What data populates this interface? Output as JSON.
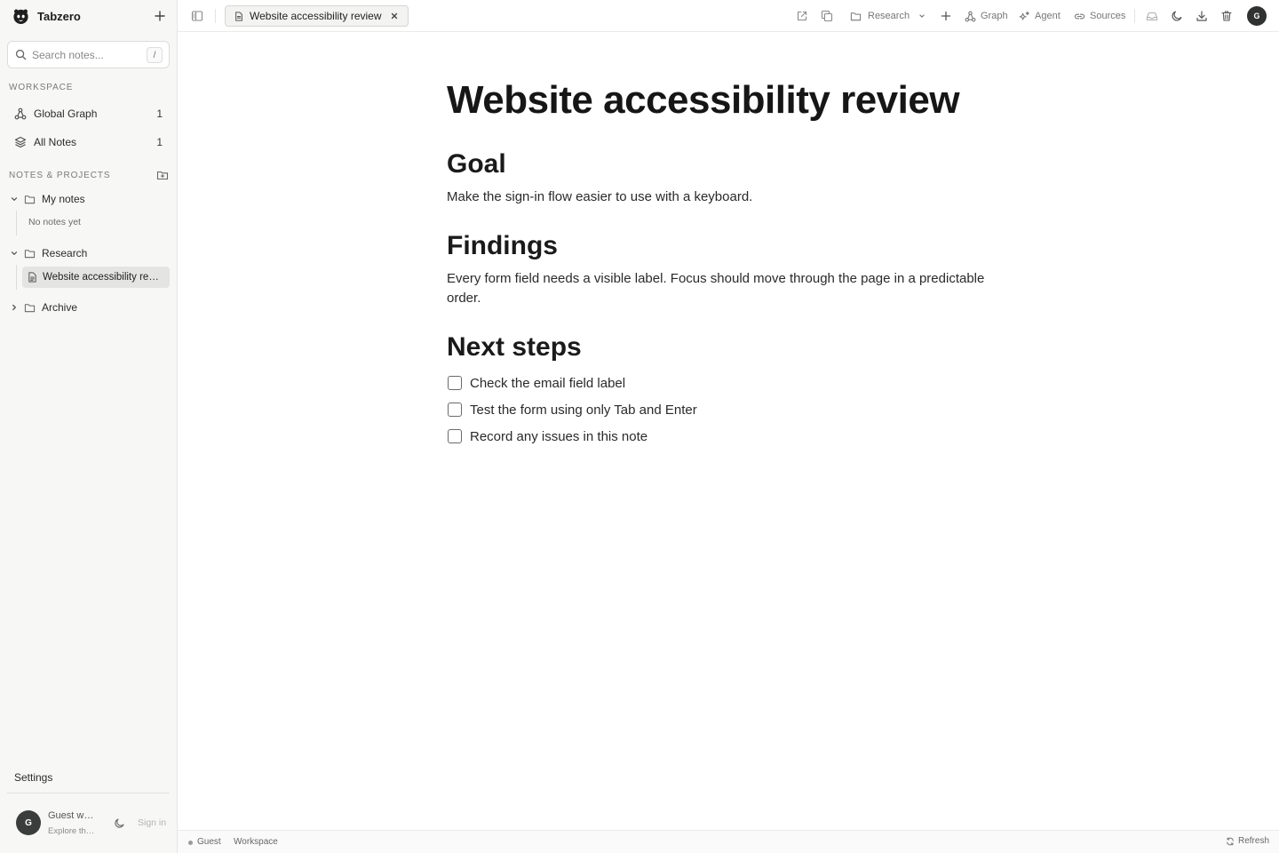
{
  "app": {
    "name": "Tabzero"
  },
  "sidebar": {
    "search": {
      "placeholder": "Search notes...",
      "shortcut": "/"
    },
    "workspace_label": "WORKSPACE",
    "workspace_items": [
      {
        "label": "Global Graph",
        "count": "1",
        "icon": "graph-icon"
      },
      {
        "label": "All Notes",
        "count": "1",
        "icon": "layers-icon"
      }
    ],
    "projects_label": "NOTES & PROJECTS",
    "folders": [
      {
        "label": "My notes",
        "expanded": true,
        "empty_text": "No notes yet"
      },
      {
        "label": "Research",
        "expanded": true,
        "notes": [
          "Website accessibility review"
        ]
      },
      {
        "label": "Archive",
        "expanded": false
      }
    ],
    "settings_label": "Settings",
    "user": {
      "avatar": "G",
      "name": "Guest workspace",
      "subtitle": "Explore the app",
      "signin_label": "Sign in"
    }
  },
  "topbar": {
    "tab_label": "Website accessibility review",
    "folder_select": "Research",
    "graph_label": "Graph",
    "agent_label": "Agent",
    "sources_label": "Sources",
    "avatar": "G"
  },
  "document": {
    "title": "Website accessibility review",
    "sections": [
      {
        "heading": "Goal",
        "text": "Make the sign-in flow easier to use with a keyboard."
      },
      {
        "heading": "Findings",
        "text": "Every form field needs a visible label. Focus should move through the page in a predictable order."
      },
      {
        "heading": "Next steps"
      }
    ],
    "tasks": [
      {
        "label": "Check the email field label",
        "checked": false
      },
      {
        "label": "Test the form using only Tab and Enter",
        "checked": false
      },
      {
        "label": "Record any issues in this note",
        "checked": false
      }
    ]
  },
  "statusbar": {
    "user": "Guest",
    "scope": "Workspace",
    "refresh_label": "Refresh"
  }
}
